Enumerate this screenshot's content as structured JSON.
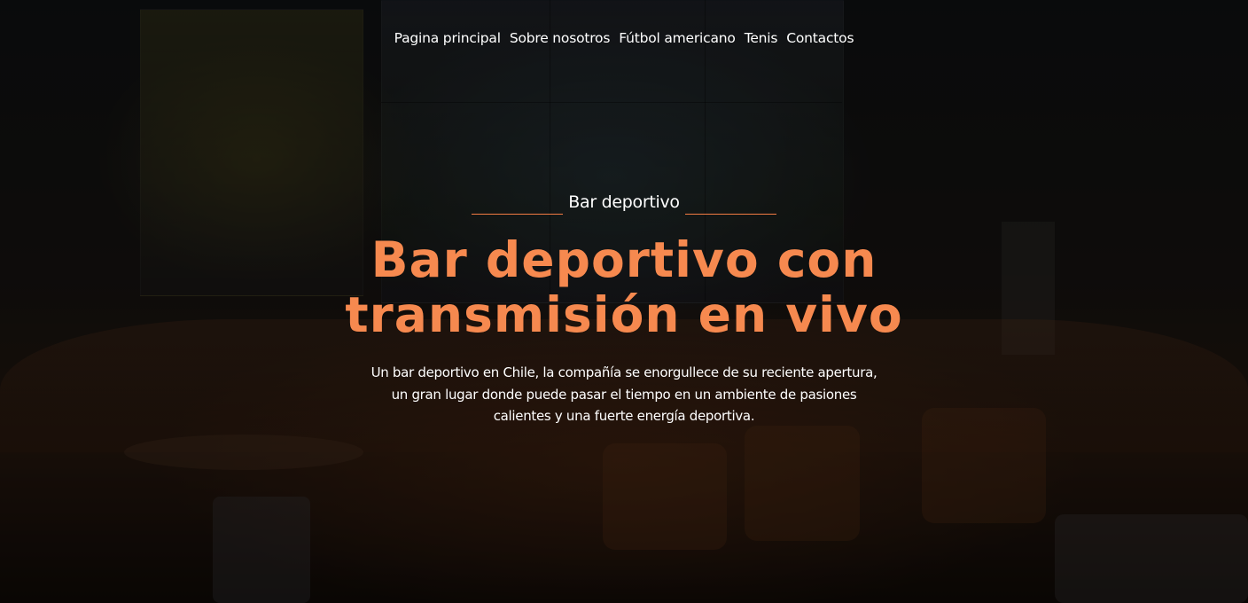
{
  "nav": {
    "items": [
      {
        "label": "Pagina principal"
      },
      {
        "label": "Sobre nosotros"
      },
      {
        "label": "Fútbol americano"
      },
      {
        "label": "Tenis"
      },
      {
        "label": "Contactos"
      }
    ]
  },
  "hero": {
    "kicker": "Bar deportivo",
    "headline": "Bar deportivo con transmisión en vivo",
    "description": "Un bar deportivo en Chile, la compañía se enorgullece de su reciente apertura, un gran lugar donde puede pasar el tiempo en un ambiente de pasiones calientes y una fuerte energía deportiva."
  },
  "colors": {
    "accent": "#f6894f",
    "text": "#ffffff",
    "overlay": "#000000"
  }
}
